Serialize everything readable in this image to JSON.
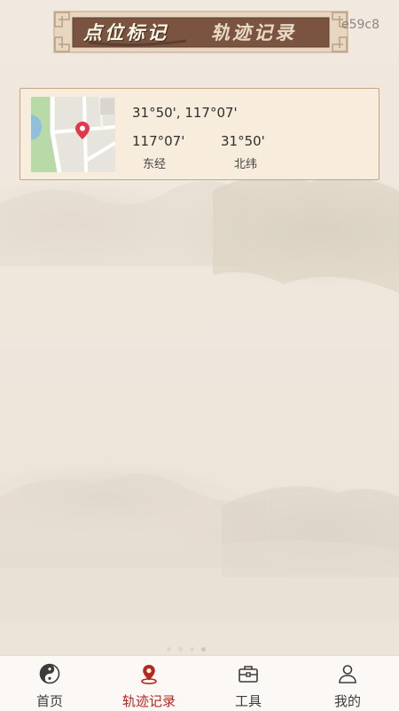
{
  "header": {
    "tab_marker": "点位标记",
    "tab_track": "轨迹记录",
    "corner_id": "e59c8"
  },
  "records": [
    {
      "coords": "31°50', 117°07'",
      "longitude_value": "117°07'",
      "longitude_label": "东经",
      "latitude_value": "31°50'",
      "latitude_label": "北纬"
    }
  ],
  "pager": {
    "count": 4,
    "active_index": 3
  },
  "bottom_nav": {
    "items": [
      {
        "label": "首页",
        "icon": "yin-yang-icon"
      },
      {
        "label": "轨迹记录",
        "icon": "location-pin-icon",
        "active": true
      },
      {
        "label": "工具",
        "icon": "toolbox-icon"
      },
      {
        "label": "我的",
        "icon": "person-icon"
      }
    ]
  },
  "colors": {
    "accent_red": "#b5281f",
    "banner_brown": "#7a5440",
    "card_border": "#c4a583",
    "background": "#efe6db"
  }
}
